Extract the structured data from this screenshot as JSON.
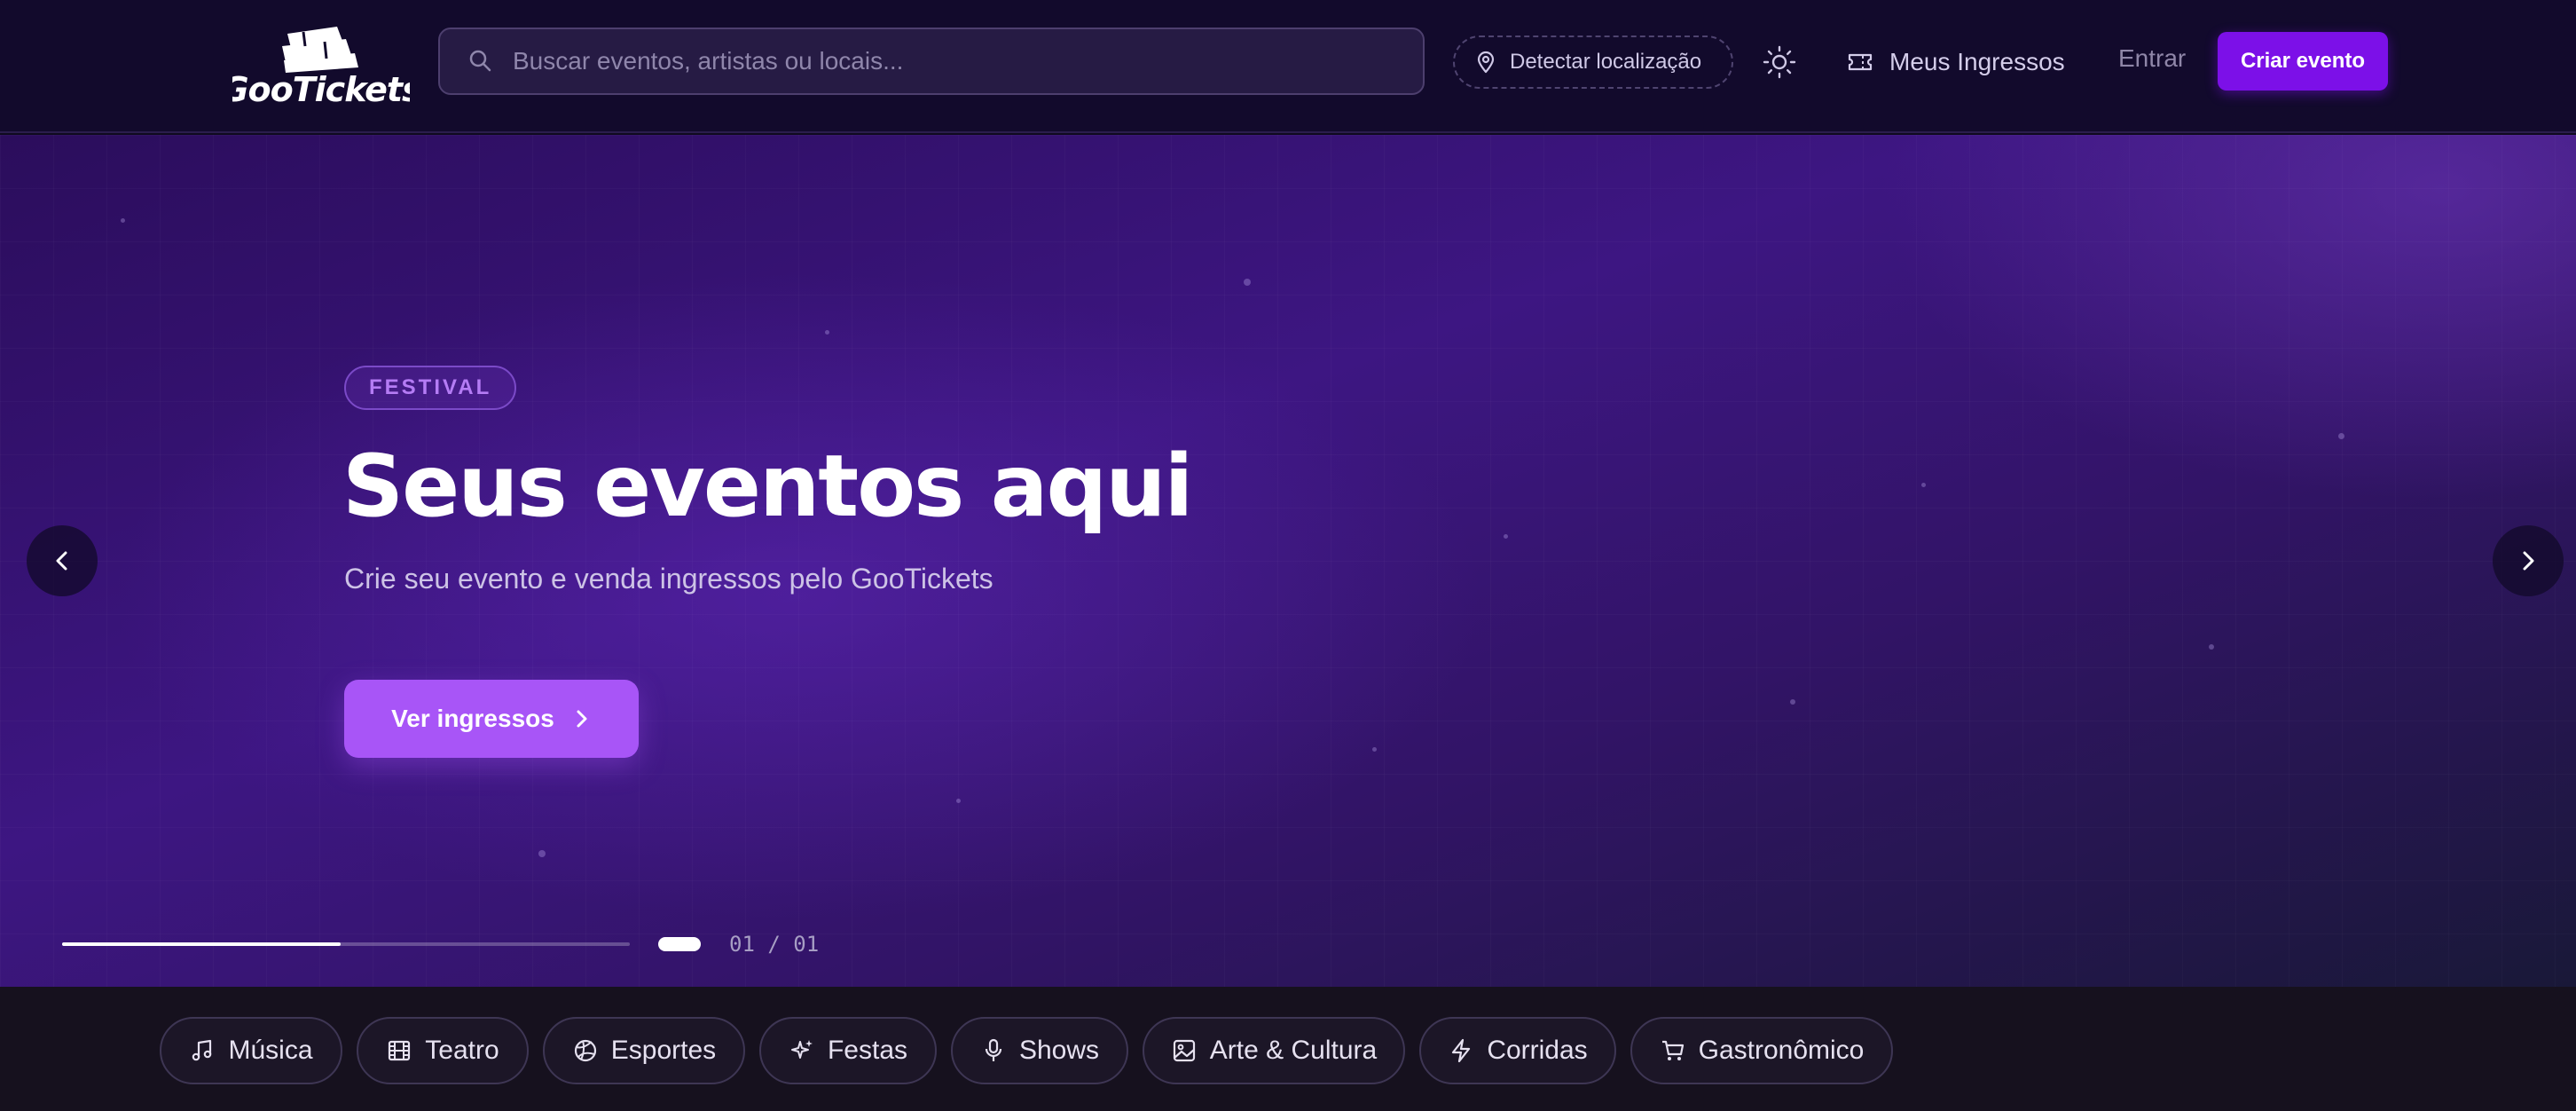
{
  "header": {
    "logo_text": "GooTickets",
    "search": {
      "placeholder": "Buscar eventos, artistas ou locais..."
    },
    "location_label": "Detectar localização",
    "tickets_label": "Meus Ingressos",
    "login_label": "Entrar",
    "create_label": "Criar evento"
  },
  "hero": {
    "badge": "FESTIVAL",
    "title": "Seus eventos aqui",
    "subtitle": "Crie seu evento e venda ingressos pelo GooTickets",
    "cta_label": "Ver ingressos",
    "counter": "01 / 01",
    "progress": 0.49
  },
  "categories": [
    {
      "label": "Música",
      "icon": "music-note-icon"
    },
    {
      "label": "Teatro",
      "icon": "film-icon"
    },
    {
      "label": "Esportes",
      "icon": "globe-ball-icon"
    },
    {
      "label": "Festas",
      "icon": "sparkles-icon"
    },
    {
      "label": "Shows",
      "icon": "microphone-icon"
    },
    {
      "label": "Arte & Cultura",
      "icon": "image-icon"
    },
    {
      "label": "Corridas",
      "icon": "lightning-icon"
    },
    {
      "label": "Gastronômico",
      "icon": "cart-icon"
    }
  ],
  "colors": {
    "brand": "#7c10e8",
    "cta": "#a855f7",
    "header_bg": "#120a2c",
    "badge_text": "#b57cf5"
  }
}
